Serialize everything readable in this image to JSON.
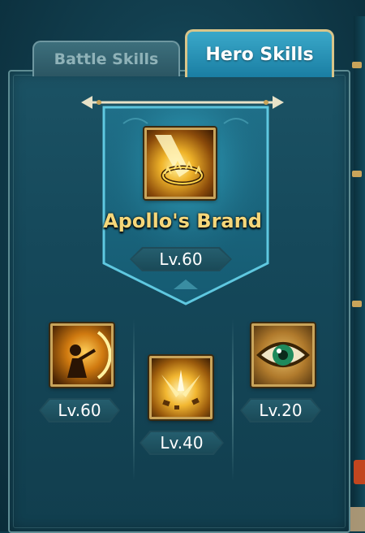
{
  "tabs": {
    "battle": "Battle Skills",
    "hero": "Hero Skills",
    "active": "hero"
  },
  "main_skill": {
    "name": "Apollo's Brand",
    "level": "Lv.60",
    "icon": "flaming-crown-icon"
  },
  "skills": [
    {
      "level": "Lv.60",
      "icon": "flaming-bow-archer-icon"
    },
    {
      "level": "Lv.40",
      "icon": "light-burst-icon"
    },
    {
      "level": "Lv.20",
      "icon": "green-eye-icon"
    }
  ],
  "colors": {
    "gold_text": "#f6d77a",
    "active_tab": "#2a94b8",
    "frame_border": "#c9a45a"
  }
}
